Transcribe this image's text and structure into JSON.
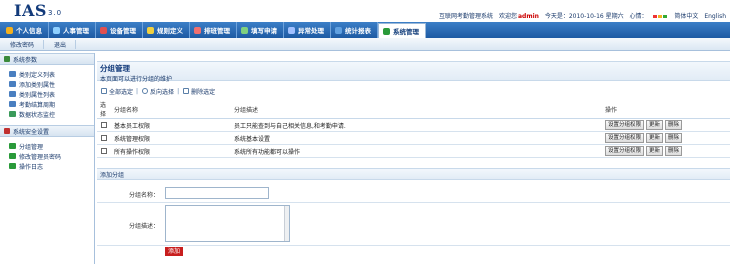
{
  "header": {
    "logo_text": "IAS",
    "logo_version": "3.0",
    "system_name": "互联网考勤管理系统",
    "welcome_prefix": "欢迎您",
    "username": "admin",
    "date_text": "今天是：2010-10-16 星期六",
    "mood_label": "心情：",
    "lang_cn": "简体中文",
    "lang_en": "English"
  },
  "topnav": {
    "items": [
      {
        "label": "个人信息",
        "color": "#f2b01e"
      },
      {
        "label": "人事管理",
        "color": "#8fd0ff"
      },
      {
        "label": "设备管理",
        "color": "#e05050"
      },
      {
        "label": "规则定义",
        "color": "#f0d040"
      },
      {
        "label": "排班管理",
        "color": "#f07070"
      },
      {
        "label": "填写申请",
        "color": "#7fd07f"
      },
      {
        "label": "异常处理",
        "color": "#a0c0ff"
      },
      {
        "label": "统计报表",
        "color": "#60a0e0"
      },
      {
        "label": "系统管理",
        "color": "#2a9a3a"
      }
    ]
  },
  "subnav": {
    "change_password": "修改密码",
    "logout": "退出"
  },
  "sidebar": {
    "sections": [
      {
        "title": "系统参数",
        "items": [
          {
            "label": "类别定义列表"
          },
          {
            "label": "添加类别属性"
          },
          {
            "label": "类别属性列表"
          },
          {
            "label": "考勤结算周期"
          },
          {
            "label": "数据状态监控"
          }
        ]
      },
      {
        "title": "系统安全设置",
        "items": [
          {
            "label": "分组管理"
          },
          {
            "label": "修改管理员密码"
          },
          {
            "label": "操作日志"
          }
        ]
      }
    ]
  },
  "main": {
    "title": "分组管理",
    "description": "本页面可以进行分组的维护",
    "toolbar": {
      "select_all": "全部选定",
      "invert": "反向选择",
      "deselect": "删除选定"
    },
    "table": {
      "columns": [
        "选择",
        "分组名称",
        "分组描述",
        "操作"
      ],
      "rows": [
        {
          "name": "基本员工权限",
          "desc": "员工只能查到与自己相关信息,和考勤申请."
        },
        {
          "name": "系统管理权限",
          "desc": "系统基本设置"
        },
        {
          "name": "所有操作权限",
          "desc": "系统所有功能都可以操作"
        }
      ],
      "op_set": "设置分组权限",
      "op_update": "更新",
      "op_delete": "删除"
    },
    "form": {
      "title": "添加分组",
      "name_label": "分组名称：",
      "desc_label": "分组描述：",
      "name_value": "",
      "desc_value": "",
      "submit": "添加"
    }
  }
}
